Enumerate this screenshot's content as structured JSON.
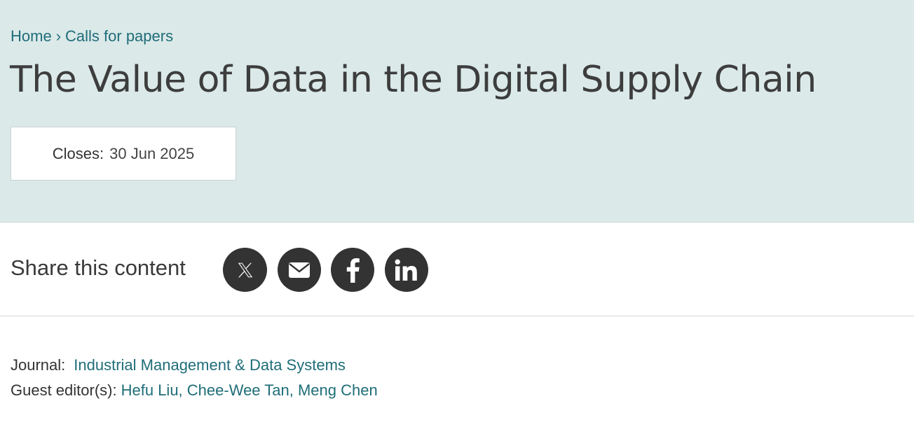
{
  "breadcrumb": {
    "home": "Home",
    "separator": "›",
    "current": "Calls for papers"
  },
  "page": {
    "title": "The Value of Data in the Digital Supply Chain"
  },
  "closes": {
    "label": "Closes:",
    "date": "30 Jun 2025"
  },
  "share": {
    "label": "Share this content",
    "buttons": [
      {
        "name": "x",
        "icon": "x-icon"
      },
      {
        "name": "email",
        "icon": "email-icon"
      },
      {
        "name": "facebook",
        "icon": "facebook-icon"
      },
      {
        "name": "linkedin",
        "icon": "linkedin-icon"
      }
    ]
  },
  "meta": {
    "journal_label": "Journal:",
    "journal_value": "Industrial Management & Data Systems",
    "editors_label": "Guest editor(s):",
    "editors_value": "Hefu Liu, Chee-Wee Tan, Meng Chen"
  },
  "colors": {
    "hero_bg": "#dbe9e9",
    "link": "#1f6d78",
    "icon_bg": "#333333"
  }
}
